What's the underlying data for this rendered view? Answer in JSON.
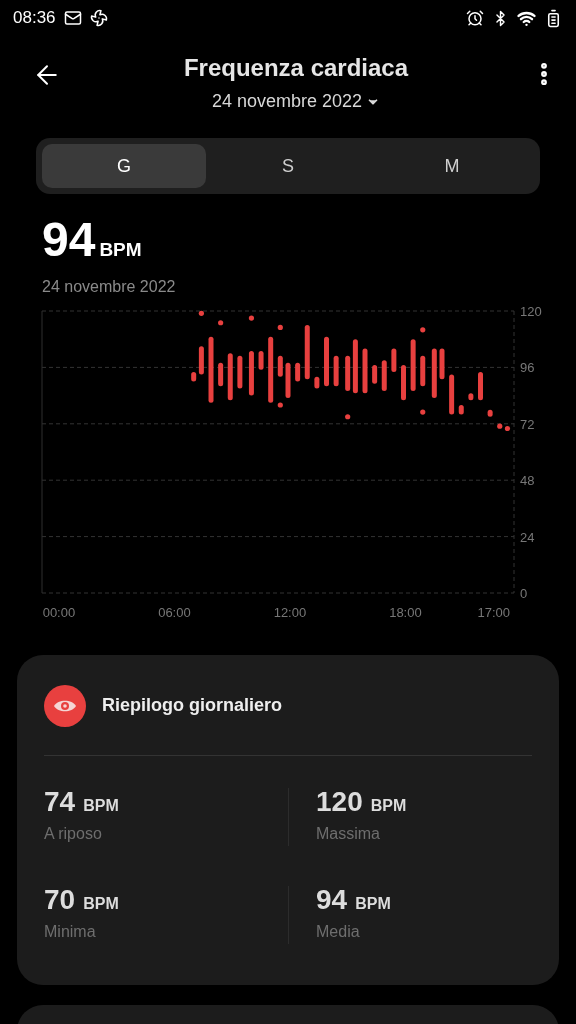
{
  "status_bar": {
    "time": "08:36"
  },
  "header": {
    "title": "Frequenza cardiaca",
    "date": "24 novembre 2022"
  },
  "tabs": [
    {
      "label": "G",
      "selected": true
    },
    {
      "label": "S",
      "selected": false
    },
    {
      "label": "M",
      "selected": false
    }
  ],
  "current": {
    "value": "94",
    "unit": "BPM",
    "date": "24 novembre 2022"
  },
  "chart": {
    "y_labels": [
      "120",
      "96",
      "72",
      "48",
      "24",
      "0"
    ],
    "x_labels": [
      "00:00",
      "06:00",
      "12:00",
      "18:00",
      "17:00"
    ]
  },
  "summary": {
    "title": "Riepilogo giornaliero",
    "stats": [
      {
        "value": "74",
        "unit": "BPM",
        "label": "A riposo"
      },
      {
        "value": "120",
        "unit": "BPM",
        "label": "Massima"
      },
      {
        "value": "70",
        "unit": "BPM",
        "label": "Minima"
      },
      {
        "value": "94",
        "unit": "BPM",
        "label": "Media"
      }
    ]
  }
}
